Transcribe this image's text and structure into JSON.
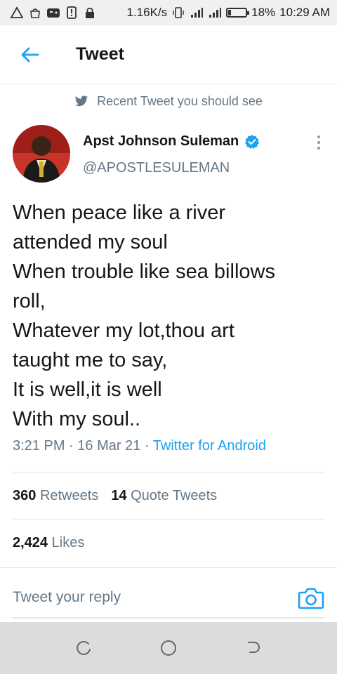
{
  "status_bar": {
    "net_speed": "1.16K/s",
    "battery_pct": "18%",
    "battery_level": 0.18,
    "time": "10:29 AM"
  },
  "header": {
    "back_icon": "arrow-left-icon",
    "title": "Tweet"
  },
  "context": {
    "icon": "twitter-bird-icon",
    "text": "Recent Tweet you should see"
  },
  "author": {
    "name": "Apst Johnson Suleman",
    "verified_icon": "verified-badge-icon",
    "handle": "@APOSTLESULEMAN"
  },
  "tweet": {
    "lines": [
      "When peace like a river",
      "attended my soul",
      "When trouble like sea billows",
      "roll,",
      "Whatever my lot,thou art",
      "taught me to say,",
      "It is well,it is well",
      "With my soul.."
    ],
    "time": "3:21 PM",
    "date": "16 Mar 21",
    "separator": "·",
    "source": "Twitter for Android"
  },
  "stats": {
    "retweets_count": "360",
    "retweets_label": "Retweets",
    "quotes_count": "14",
    "quotes_label": "Quote Tweets",
    "likes_count": "2,424",
    "likes_label": "Likes"
  },
  "reply": {
    "placeholder": "Tweet your reply",
    "camera_icon": "camera-icon"
  },
  "colors": {
    "accent": "#1da1f2",
    "secondary_text": "#657786",
    "primary_text": "#14171a"
  }
}
